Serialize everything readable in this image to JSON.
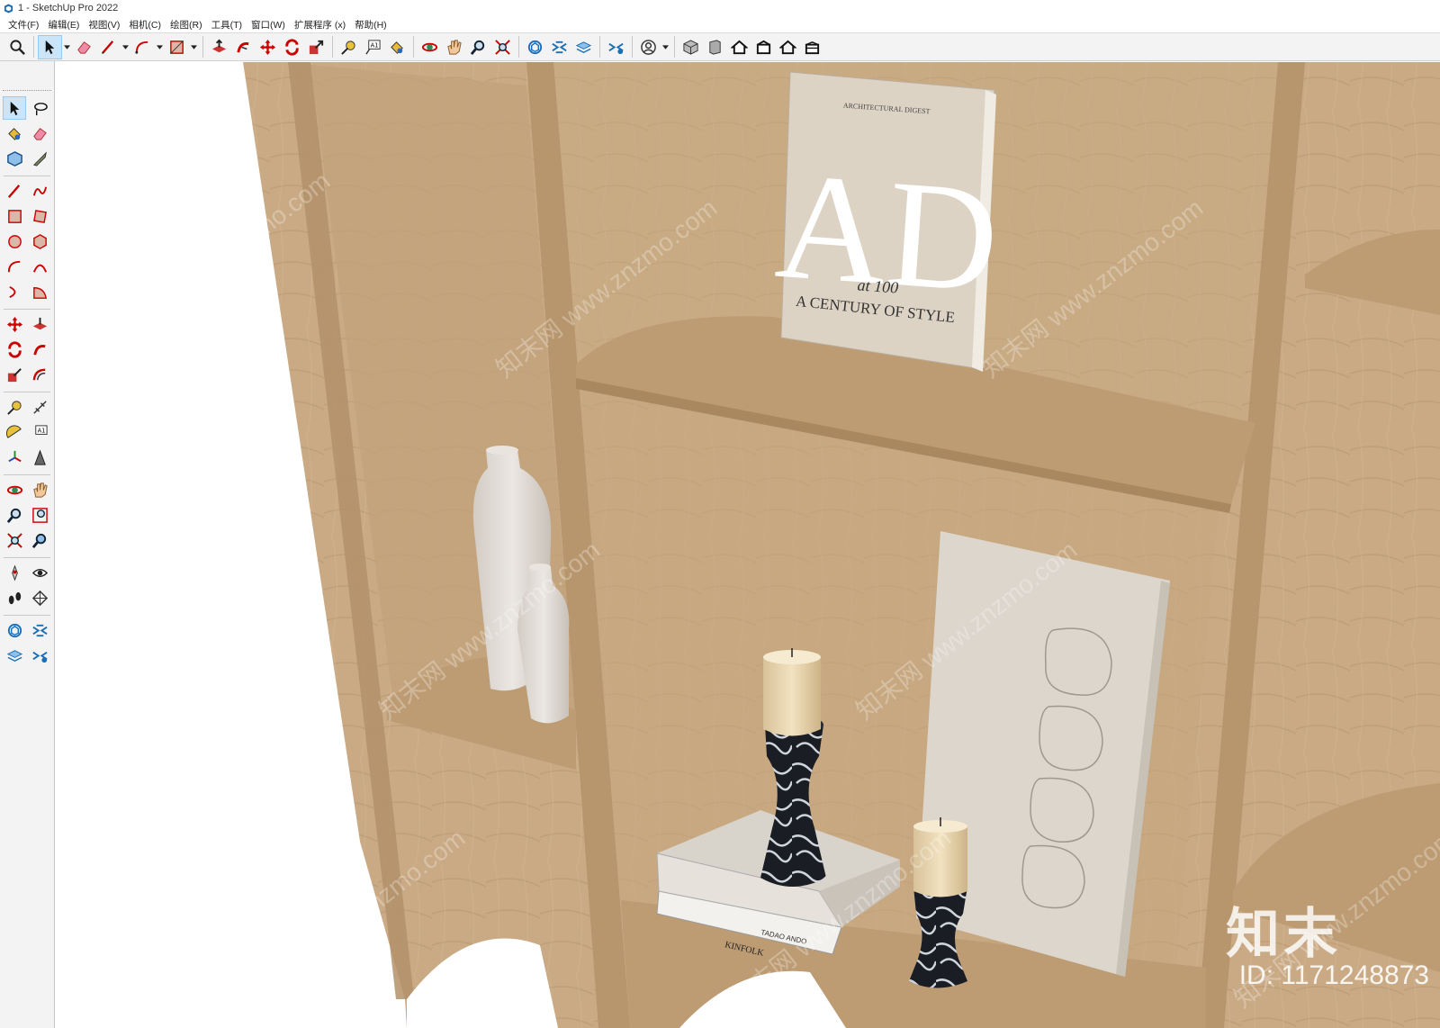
{
  "window": {
    "title": "1 - SketchUp Pro 2022"
  },
  "menu": {
    "items": [
      "文件(F)",
      "编辑(E)",
      "视图(V)",
      "相机(C)",
      "绘图(R)",
      "工具(T)",
      "窗口(W)",
      "扩展程序 (x)",
      "帮助(H)"
    ]
  },
  "book": {
    "publisher": "ARCHITECTURAL DIGEST",
    "monogram": "AD",
    "subtitle": "at 100",
    "tagline": "A CENTURY OF STYLE"
  },
  "small_books": {
    "top_spine": "TADAO ANDO",
    "bottom_spine": "KINFOLK"
  },
  "watermark": {
    "text": "知末网 www.znzmo.com",
    "brand": "知末",
    "id": "ID: 1171248873"
  },
  "colors": {
    "wood": "#c8a983",
    "wood_dark": "#b3926a",
    "toolbar": "#f3f3f3",
    "selection": "#cce4f7"
  }
}
